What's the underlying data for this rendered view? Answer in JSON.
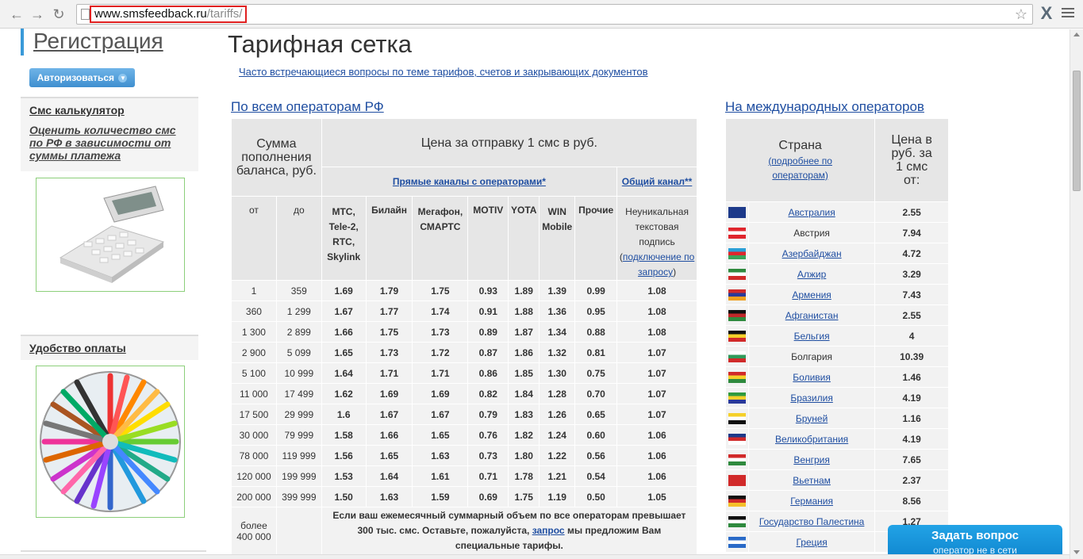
{
  "browser": {
    "url_host": "www.smsfeedback.ru",
    "url_path": "/tariffs/",
    "back_icon": "arrow-left-icon",
    "forward_icon": "arrow-right-icon",
    "reload_icon": "reload-icon"
  },
  "sidebar": {
    "register_title": "Регистрация",
    "auth_button": "Авторизоваться",
    "calc_heading": "Смс калькулятор",
    "calc_link": "Оценить количество смс по РФ в зависимости от суммы платежа",
    "payment_heading": "Удобство оплаты"
  },
  "main": {
    "title": "Тарифная сетка",
    "faq_link": "Часто встречающиеся вопросы по теме тарифов, счетов и закрывающих документов",
    "rf_link": "По всем операторам РФ",
    "intl_link": "На международных операторов"
  },
  "rf_table": {
    "h_sum": "Сумма пополнения баланса, руб.",
    "h_price": "Цена за отправку 1 смс в руб.",
    "h_direct": "Прямые каналы с операторами*",
    "h_common": "Общий канал**",
    "h_from": "от",
    "h_to": "до",
    "ops": [
      "МТС, Tele-2, RTC, Skylink",
      "Билайн",
      "Мегафон, СМАРТС",
      "MOTIV",
      "YOTA",
      "WIN Mobile",
      "Прочие"
    ],
    "common_note_1": "Неуникальная текстовая подпись",
    "common_note_link": "подключение по запросу",
    "rows": [
      [
        "1",
        "359",
        "1.69",
        "1.79",
        "1.75",
        "0.93",
        "1.89",
        "1.39",
        "0.99",
        "1.08"
      ],
      [
        "360",
        "1 299",
        "1.67",
        "1.77",
        "1.74",
        "0.91",
        "1.88",
        "1.36",
        "0.95",
        "1.08"
      ],
      [
        "1 300",
        "2 899",
        "1.66",
        "1.75",
        "1.73",
        "0.89",
        "1.87",
        "1.34",
        "0.88",
        "1.08"
      ],
      [
        "2 900",
        "5 099",
        "1.65",
        "1.73",
        "1.72",
        "0.87",
        "1.86",
        "1.32",
        "0.81",
        "1.07"
      ],
      [
        "5 100",
        "10 999",
        "1.64",
        "1.71",
        "1.71",
        "0.86",
        "1.85",
        "1.30",
        "0.75",
        "1.07"
      ],
      [
        "11 000",
        "17 499",
        "1.62",
        "1.69",
        "1.69",
        "0.82",
        "1.84",
        "1.28",
        "0.70",
        "1.07"
      ],
      [
        "17 500",
        "29 999",
        "1.6",
        "1.67",
        "1.67",
        "0.79",
        "1.83",
        "1.26",
        "0.65",
        "1.07"
      ],
      [
        "30 000",
        "79 999",
        "1.58",
        "1.66",
        "1.65",
        "0.76",
        "1.82",
        "1.24",
        "0.60",
        "1.06"
      ],
      [
        "78 000",
        "119 999",
        "1.56",
        "1.65",
        "1.63",
        "0.73",
        "1.80",
        "1.22",
        "0.56",
        "1.06"
      ],
      [
        "120 000",
        "199 999",
        "1.53",
        "1.64",
        "1.61",
        "0.71",
        "1.78",
        "1.21",
        "0.54",
        "1.06"
      ],
      [
        "200 000",
        "399 999",
        "1.50",
        "1.63",
        "1.59",
        "0.69",
        "1.75",
        "1.19",
        "0.50",
        "1.05"
      ]
    ],
    "last_from": "более 400 000",
    "last_text_1": "Если ваш ежемесячный суммарный объем по все операторам превышает 300 тыс. смс. Оставьте, пожалуйста,",
    "last_link": "запрос",
    "last_text_2": "мы предложим Вам специальные тарифы."
  },
  "intl_table": {
    "h_country": "Страна",
    "h_more_link": "(подробнее по операторам)",
    "h_price": "Цена в руб. за 1 смс от:",
    "rows": [
      {
        "country": "Австралия",
        "price": "2.55",
        "link": true,
        "flag": [
          "#1d3a8a",
          "#1d3a8a",
          "#1d3a8a"
        ]
      },
      {
        "country": "Австрия",
        "price": "7.94",
        "link": false,
        "flag": [
          "#e0262d",
          "#ffffff",
          "#e0262d"
        ]
      },
      {
        "country": "Азербайджан",
        "price": "4.72",
        "link": true,
        "flag": [
          "#2aa0d8",
          "#e0262d",
          "#3aa35a"
        ]
      },
      {
        "country": "Алжир",
        "price": "3.29",
        "link": true,
        "flag": [
          "#2f8a3e",
          "#ffffff",
          "#d12a2a"
        ]
      },
      {
        "country": "Армения",
        "price": "7.43",
        "link": true,
        "flag": [
          "#d12a2a",
          "#2a3a9a",
          "#f0a020"
        ]
      },
      {
        "country": "Афганистан",
        "price": "2.55",
        "link": true,
        "flag": [
          "#111111",
          "#c0282a",
          "#2f8a3e"
        ]
      },
      {
        "country": "Бельгия",
        "price": "4",
        "link": true,
        "flag": [
          "#111111",
          "#f5d02a",
          "#d12a2a"
        ]
      },
      {
        "country": "Болгария",
        "price": "10.39",
        "link": false,
        "flag": [
          "#ffffff",
          "#2f9a5a",
          "#d12a2a"
        ]
      },
      {
        "country": "Боливия",
        "price": "1.46",
        "link": true,
        "flag": [
          "#d12a2a",
          "#f5d02a",
          "#2f8a3e"
        ]
      },
      {
        "country": "Бразилия",
        "price": "4.19",
        "link": true,
        "flag": [
          "#2f9a3e",
          "#f5d02a",
          "#2a3a9a"
        ]
      },
      {
        "country": "Бруней",
        "price": "1.16",
        "link": true,
        "flag": [
          "#f5d02a",
          "#ffffff",
          "#111111"
        ]
      },
      {
        "country": "Великобритания",
        "price": "4.19",
        "link": true,
        "flag": [
          "#1d3a8a",
          "#d12a2a",
          "#ffffff"
        ]
      },
      {
        "country": "Венгрия",
        "price": "7.65",
        "link": true,
        "flag": [
          "#d12a2a",
          "#ffffff",
          "#2f8a3e"
        ]
      },
      {
        "country": "Вьетнам",
        "price": "2.37",
        "link": true,
        "flag": [
          "#d12a2a",
          "#d12a2a",
          "#d12a2a"
        ]
      },
      {
        "country": "Германия",
        "price": "8.56",
        "link": true,
        "flag": [
          "#111111",
          "#d12a2a",
          "#f5c02a"
        ]
      },
      {
        "country": "Государство Палестина",
        "price": "1.27",
        "link": true,
        "flag": [
          "#111111",
          "#ffffff",
          "#2f8a3e"
        ]
      },
      {
        "country": "Греция",
        "price": "",
        "link": true,
        "flag": [
          "#2a6ac8",
          "#ffffff",
          "#2a6ac8"
        ]
      }
    ]
  },
  "chat": {
    "title": "Задать вопрос",
    "subtitle": "оператор не в сети"
  }
}
